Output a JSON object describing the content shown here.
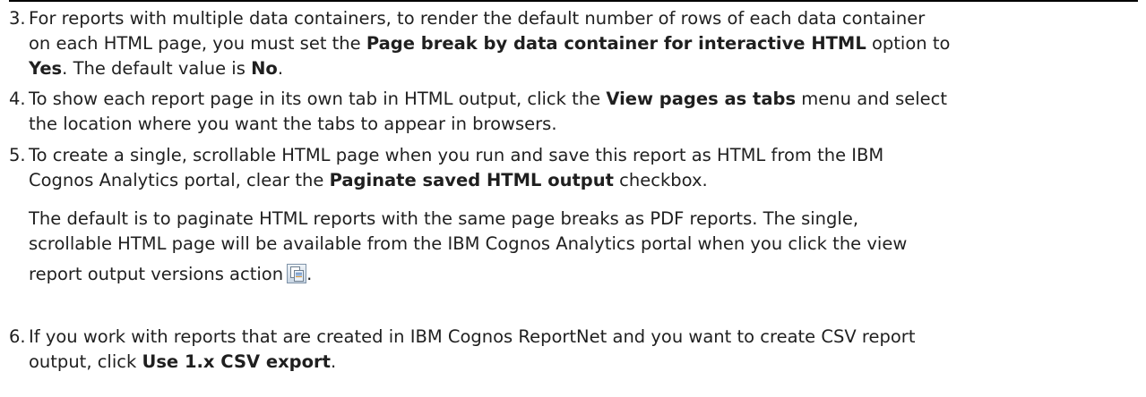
{
  "steps": [
    {
      "number": "3.",
      "line1": [
        "For reports with multiple data containers, to render the default number of rows of each data container"
      ],
      "line2": [
        "on each HTML page, you must set the ",
        {
          "b": "Page break by data container for interactive HTML"
        },
        " option to"
      ],
      "line3": [
        {
          "b": "Yes"
        },
        ". The default value is ",
        {
          "b": "No"
        },
        "."
      ]
    },
    {
      "number": "4.",
      "line1": [
        "To show each report page in its own tab in HTML output, click the ",
        {
          "b": "View pages as tabs"
        },
        " menu and select"
      ],
      "line2": [
        "the location where you want the tabs to appear in browsers."
      ]
    },
    {
      "number": "5.",
      "line1": [
        "To create a single, scrollable HTML page when you run and save this report as HTML from the IBM"
      ],
      "line2": [
        "Cognos Analytics portal, clear the ",
        {
          "b": "Paginate saved HTML output"
        },
        " checkbox."
      ],
      "para_line1": "The default is to paginate HTML reports with the same page breaks as PDF reports. The single,",
      "para_line2": "scrollable HTML page will be available from the IBM Cognos Analytics portal when you click the view",
      "para_line3": "report output versions action",
      "para_end": ".",
      "icon": "report-output-versions-icon"
    },
    {
      "number": "6.",
      "line1": [
        "If you work with reports that are created in IBM Cognos ReportNet and you want to create CSV report"
      ],
      "line2": [
        "output, click ",
        {
          "b": "Use 1.x CSV export"
        },
        "."
      ]
    }
  ]
}
